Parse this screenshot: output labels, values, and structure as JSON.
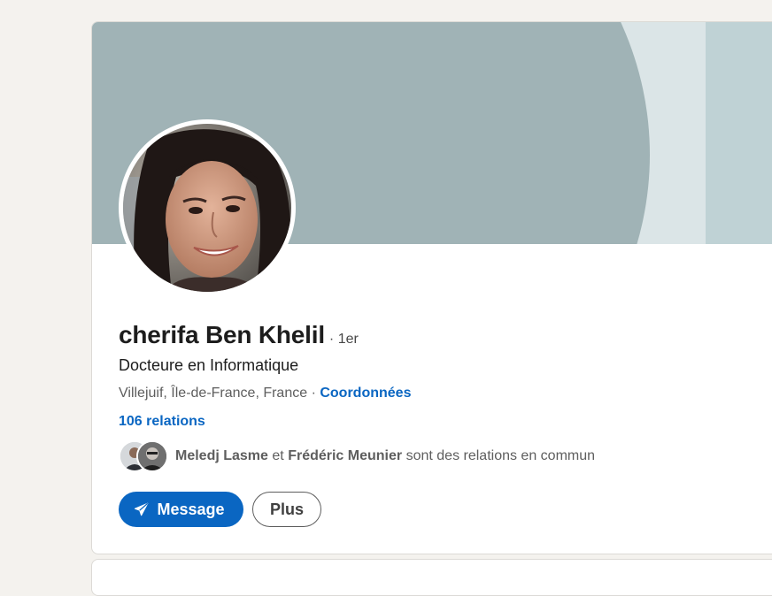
{
  "profile": {
    "name": "cherifa Ben Khelil",
    "degree": "· 1er",
    "headline": "Docteure en Informatique",
    "location": "Villejuif, Île-de-France, France",
    "location_separator": " · ",
    "contact_link": "Coordonnées",
    "relations_link": "106 relations"
  },
  "mutual": {
    "person1": "Meledj Lasme",
    "connector": "et",
    "person2": "Frédéric Meunier",
    "suffix": "sont des relations en commun"
  },
  "actions": {
    "message_label": "Message",
    "more_label": "Plus"
  },
  "icons": {
    "message": "send-paper-plane-icon"
  },
  "colors": {
    "accent": "#0a66c2",
    "banner_dark": "#a0b3b6",
    "banner_light": "#dbe5e7",
    "banner_right": "#bfd2d5"
  }
}
